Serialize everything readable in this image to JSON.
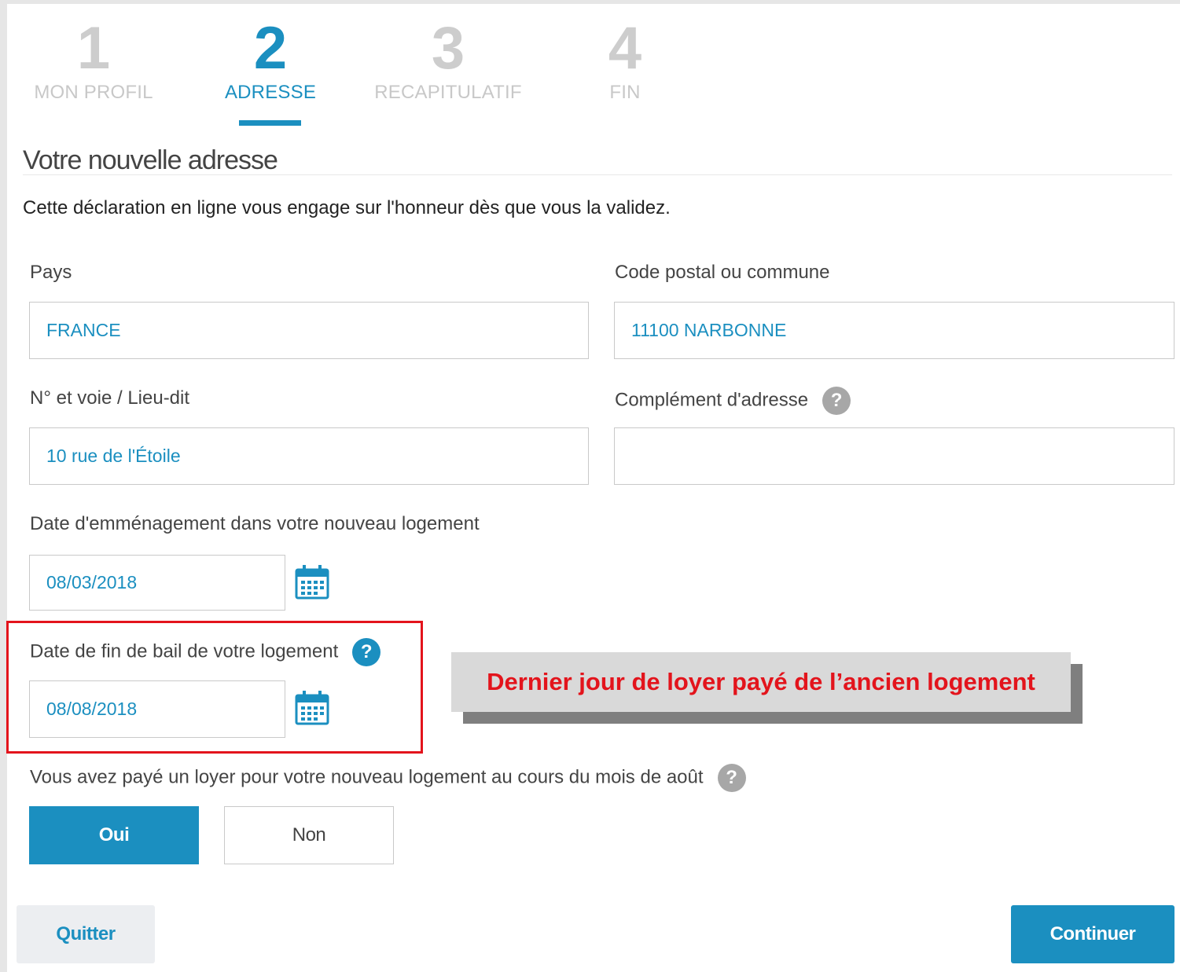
{
  "stepper": {
    "steps": [
      {
        "num": "1",
        "label": "MON PROFIL"
      },
      {
        "num": "2",
        "label": "ADRESSE"
      },
      {
        "num": "3",
        "label": "RECAPITULATIF"
      },
      {
        "num": "4",
        "label": "FIN"
      }
    ],
    "active_index": 2
  },
  "section": {
    "title": "Votre nouvelle adresse",
    "intro": "Cette déclaration en ligne vous engage sur l'honneur dès que vous la validez."
  },
  "form": {
    "pays_label": "Pays",
    "pays_value": "FRANCE",
    "cp_label": "Code postal ou commune",
    "cp_value": "11100 NARBONNE",
    "voie_label": "N° et voie / Lieu-dit",
    "voie_value": "10 rue de l'Étoile",
    "complement_label": "Complément d'adresse",
    "complement_value": "",
    "date_emmenagement_label": "Date d'emménagement dans votre nouveau logement",
    "date_emmenagement_value": "08/03/2018",
    "date_fin_bail_label": "Date de fin de bail de votre logement",
    "date_fin_bail_value": "08/08/2018",
    "loyer_question": "Vous avez payé un loyer pour votre nouveau logement au cours du mois de août",
    "oui_label": "Oui",
    "non_label": "Non",
    "selected": "Oui"
  },
  "annotation": {
    "callout_text": "Dernier jour de loyer payé de l’ancien logement"
  },
  "actions": {
    "quit_label": "Quitter",
    "continue_label": "Continuer"
  },
  "icons": {
    "help": "question-circle-icon",
    "calendar": "calendar-icon"
  },
  "colors": {
    "accent": "#1b8fc0",
    "annotation_red": "#e3141c",
    "inactive_step": "#cdcdcd"
  }
}
